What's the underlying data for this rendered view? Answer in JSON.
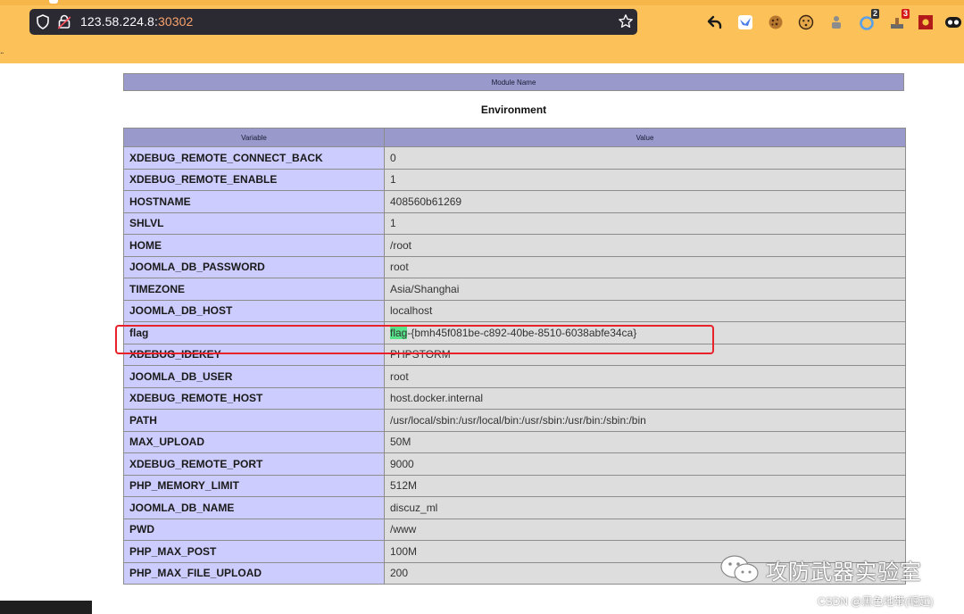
{
  "browser": {
    "url_host": "123.58.224.8:",
    "url_port": "30302",
    "overflow_text": "..",
    "extensions": [
      {
        "icon": "back-arrow-icon"
      },
      {
        "icon": "bird-icon"
      },
      {
        "icon": "cookie-icon"
      },
      {
        "icon": "cookie-face-icon"
      },
      {
        "icon": "puzzle-figure-icon"
      },
      {
        "icon": "ring-icon",
        "badge": "2"
      },
      {
        "icon": "hammer-icon",
        "badge": "3"
      },
      {
        "icon": "sun-square-icon"
      },
      {
        "icon": "mask-icon"
      }
    ]
  },
  "page": {
    "module_name_header": "Module Name",
    "section_title": "Environment",
    "table_headers": {
      "variable": "Variable",
      "value": "Value"
    },
    "rows": [
      {
        "variable": "XDEBUG_REMOTE_CONNECT_BACK",
        "value": "0"
      },
      {
        "variable": "XDEBUG_REMOTE_ENABLE",
        "value": "1"
      },
      {
        "variable": "HOSTNAME",
        "value": "408560b61269"
      },
      {
        "variable": "SHLVL",
        "value": "1"
      },
      {
        "variable": "HOME",
        "value": "/root"
      },
      {
        "variable": "JOOMLA_DB_PASSWORD",
        "value": "root"
      },
      {
        "variable": "TIMEZONE",
        "value": "Asia/Shanghai"
      },
      {
        "variable": "JOOMLA_DB_HOST",
        "value": "localhost"
      },
      {
        "variable": "flag",
        "value_highlight": "flag",
        "value": "-{bmh45f081be-c892-40be-8510-6038abfe34ca}"
      },
      {
        "variable": "XDEBUG_IDEKEY",
        "value": "PHPSTORM"
      },
      {
        "variable": "JOOMLA_DB_USER",
        "value": "root"
      },
      {
        "variable": "XDEBUG_REMOTE_HOST",
        "value": "host.docker.internal"
      },
      {
        "variable": "PATH",
        "value": "/usr/local/sbin:/usr/local/bin:/usr/sbin:/usr/bin:/sbin:/bin"
      },
      {
        "variable": "MAX_UPLOAD",
        "value": "50M"
      },
      {
        "variable": "XDEBUG_REMOTE_PORT",
        "value": "9000"
      },
      {
        "variable": "PHP_MEMORY_LIMIT",
        "value": "512M"
      },
      {
        "variable": "JOOMLA_DB_NAME",
        "value": "discuz_ml"
      },
      {
        "variable": "PWD",
        "value": "/www"
      },
      {
        "variable": "PHP_MAX_POST",
        "value": "100M"
      },
      {
        "variable": "PHP_MAX_FILE_UPLOAD",
        "value": "200"
      }
    ]
  },
  "watermark": {
    "text": "攻防武器实验室",
    "csdn": "CSDN @黑色地带(崛起)"
  },
  "colors": {
    "toolbar": "#fdc15a",
    "header_bg": "#9999cc",
    "var_cell": "#ccccff",
    "value_cell": "#dddddd",
    "highlight": "#57e389",
    "annotation_box": "#e8222a"
  }
}
